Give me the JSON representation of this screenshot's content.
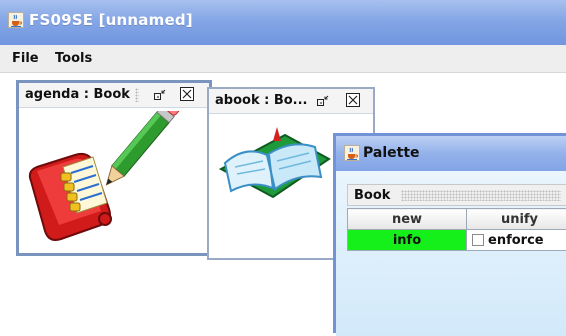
{
  "window": {
    "title": "FS09SE [unnamed]",
    "icon": "java-cup-icon"
  },
  "menu": {
    "items": [
      {
        "label": "File"
      },
      {
        "label": "Tools"
      }
    ]
  },
  "frames": [
    {
      "title": "agenda : Book",
      "controls": [
        "restore-icon",
        "close-icon"
      ],
      "image": "agenda-with-pencil-icon"
    },
    {
      "title": "abook : Bo...",
      "controls": [
        "restore-icon",
        "close-icon"
      ],
      "image": "open-book-icon"
    }
  ],
  "palette": {
    "title": "Palette",
    "icon": "java-cup-icon",
    "toolbar_label": "Book",
    "table": {
      "headers": [
        "new",
        "unify"
      ],
      "rows": [
        {
          "button": "info",
          "checkbox_label": "enforce",
          "checked": false
        }
      ]
    },
    "colors": {
      "info_button": "#16f01a",
      "title_bar": "#8aa9e7"
    }
  },
  "colors": {
    "title_bar": "#7fa1e3",
    "frame_border": "#7b93bf"
  }
}
